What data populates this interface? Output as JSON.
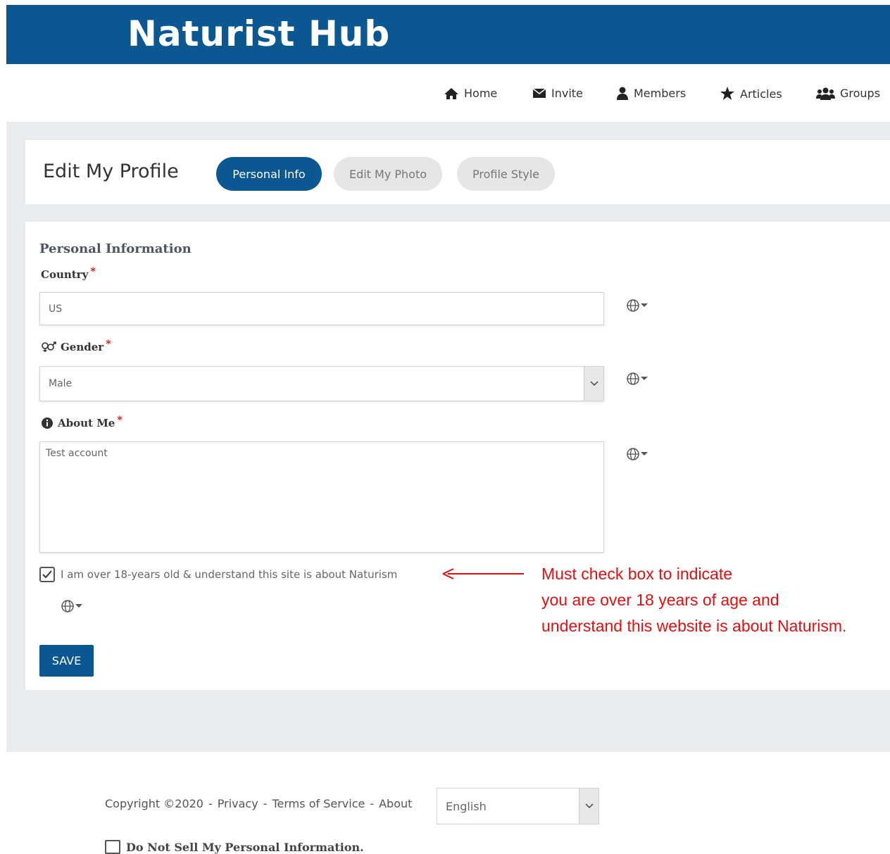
{
  "header": {
    "brand": "Naturist Hub"
  },
  "nav": {
    "items": [
      {
        "label": "Home",
        "icon": "home-icon"
      },
      {
        "label": "Invite",
        "icon": "envelope-icon"
      },
      {
        "label": "Members",
        "icon": "user-icon"
      },
      {
        "label": "Articles",
        "icon": "star-icon"
      },
      {
        "label": "Groups",
        "icon": "users-icon"
      }
    ]
  },
  "profile": {
    "title": "Edit My Profile",
    "tabs": [
      {
        "label": "Personal Info",
        "active": true
      },
      {
        "label": "Edit My Photo",
        "active": false
      },
      {
        "label": "Profile Style",
        "active": false
      }
    ]
  },
  "form": {
    "section_title": "Personal Information",
    "country": {
      "label": "Country",
      "required": "*",
      "value": "US"
    },
    "gender": {
      "label": "Gender",
      "required": "*",
      "value": "Male"
    },
    "about": {
      "label": "About Me",
      "required": "*",
      "value": "Test account"
    },
    "consent": {
      "label": "I am over 18-years old & understand this site is about Naturism",
      "checked": true
    },
    "save_label": "SAVE"
  },
  "annotation": {
    "lines": [
      "Must check box to indicate",
      "you are over 18 years of age and",
      "understand this website is about Naturism."
    ],
    "color": "#e01010"
  },
  "footer": {
    "copyright": "Copyright ©2020",
    "sep": "-",
    "privacy": "Privacy",
    "terms": "Terms of Service",
    "about": "About",
    "language": "English",
    "do_not_sell": "Do Not Sell My Personal Information."
  },
  "colors": {
    "brand": "#0a5791",
    "background": "#e9ecef"
  }
}
